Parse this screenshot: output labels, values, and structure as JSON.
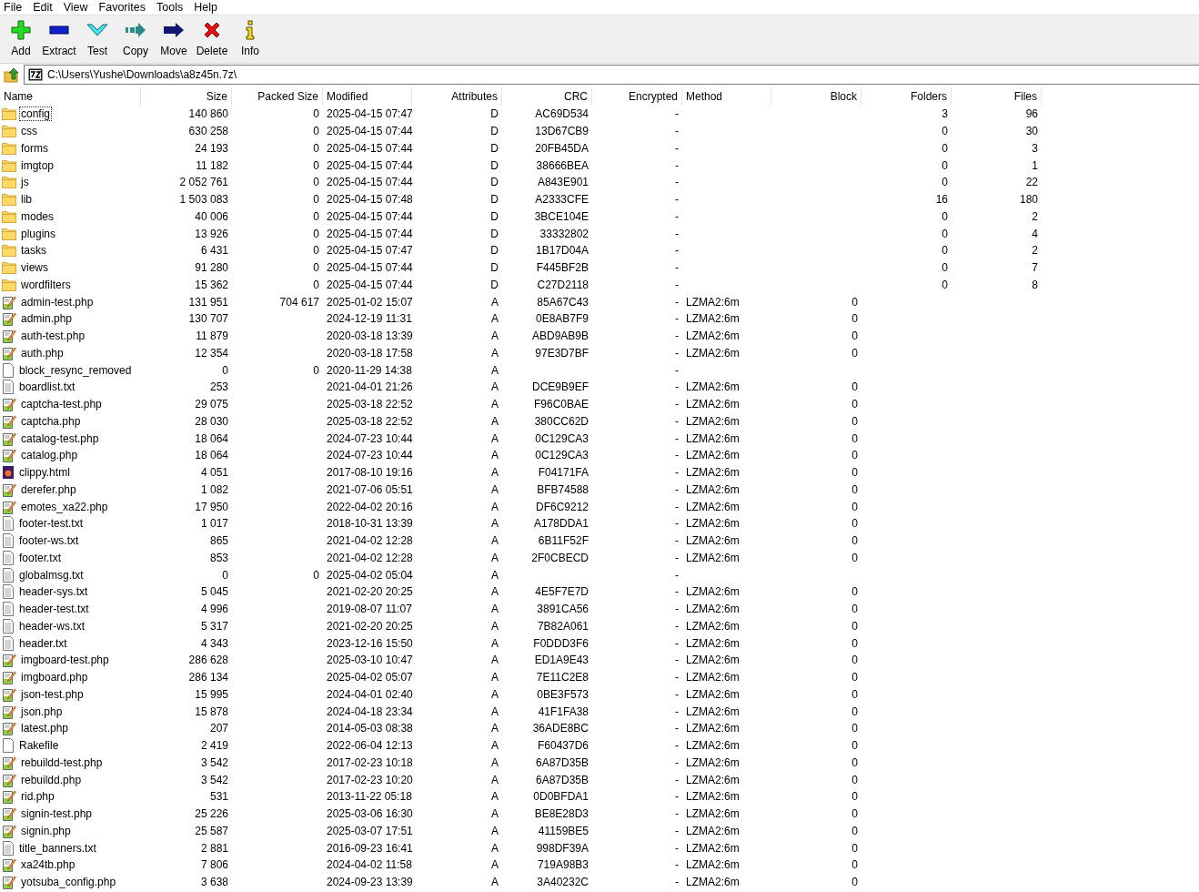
{
  "menu": [
    "File",
    "Edit",
    "View",
    "Favorites",
    "Tools",
    "Help"
  ],
  "toolbar": [
    {
      "kind": "add",
      "label": "Add"
    },
    {
      "kind": "extract",
      "label": "Extract"
    },
    {
      "kind": "test",
      "label": "Test"
    },
    {
      "kind": "copy",
      "label": "Copy"
    },
    {
      "kind": "move",
      "label": "Move"
    },
    {
      "kind": "delete",
      "label": "Delete"
    },
    {
      "kind": "info",
      "label": "Info"
    }
  ],
  "address": {
    "value": "C:\\Users\\Yushe\\Downloads\\a8z45n.7z\\"
  },
  "columns": [
    "Name",
    "Size",
    "Packed Size",
    "Modified",
    "Attributes",
    "CRC",
    "Encrypted",
    "Method",
    "Block",
    "Folders",
    "Files"
  ],
  "rows": [
    {
      "kind": "folder",
      "selected": true,
      "name": "config",
      "size": "140 860",
      "packed_size": "0",
      "modified": "2025-04-15 07:47",
      "attributes": "D",
      "crc": "AC69D534",
      "encrypted": "-",
      "folders": "3",
      "files": "96"
    },
    {
      "kind": "folder",
      "selected": false,
      "name": "css",
      "size": "630 258",
      "packed_size": "0",
      "modified": "2025-04-15 07:44",
      "attributes": "D",
      "crc": "13D67CB9",
      "encrypted": "-",
      "folders": "0",
      "files": "30"
    },
    {
      "kind": "folder",
      "selected": false,
      "name": "forms",
      "size": "24 193",
      "packed_size": "0",
      "modified": "2025-04-15 07:44",
      "attributes": "D",
      "crc": "20FB45DA",
      "encrypted": "-",
      "folders": "0",
      "files": "3"
    },
    {
      "kind": "folder",
      "selected": false,
      "name": "imgtop",
      "size": "11 182",
      "packed_size": "0",
      "modified": "2025-04-15 07:44",
      "attributes": "D",
      "crc": "38666BEA",
      "encrypted": "-",
      "folders": "0",
      "files": "1"
    },
    {
      "kind": "folder",
      "selected": false,
      "name": "js",
      "size": "2 052 761",
      "packed_size": "0",
      "modified": "2025-04-15 07:44",
      "attributes": "D",
      "crc": "A843E901",
      "encrypted": "-",
      "folders": "0",
      "files": "22"
    },
    {
      "kind": "folder",
      "selected": false,
      "name": "lib",
      "size": "1 503 083",
      "packed_size": "0",
      "modified": "2025-04-15 07:48",
      "attributes": "D",
      "crc": "A2333CFE",
      "encrypted": "-",
      "folders": "16",
      "files": "180"
    },
    {
      "kind": "folder",
      "selected": false,
      "name": "modes",
      "size": "40 006",
      "packed_size": "0",
      "modified": "2025-04-15 07:44",
      "attributes": "D",
      "crc": "3BCE104E",
      "encrypted": "-",
      "folders": "0",
      "files": "2"
    },
    {
      "kind": "folder",
      "selected": false,
      "name": "plugins",
      "size": "13 926",
      "packed_size": "0",
      "modified": "2025-04-15 07:44",
      "attributes": "D",
      "crc": "33332802",
      "encrypted": "-",
      "folders": "0",
      "files": "4"
    },
    {
      "kind": "folder",
      "selected": false,
      "name": "tasks",
      "size": "6 431",
      "packed_size": "0",
      "modified": "2025-04-15 07:47",
      "attributes": "D",
      "crc": "1B17D04A",
      "encrypted": "-",
      "folders": "0",
      "files": "2"
    },
    {
      "kind": "folder",
      "selected": false,
      "name": "views",
      "size": "91 280",
      "packed_size": "0",
      "modified": "2025-04-15 07:44",
      "attributes": "D",
      "crc": "F445BF2B",
      "encrypted": "-",
      "folders": "0",
      "files": "7"
    },
    {
      "kind": "folder",
      "selected": false,
      "name": "wordfilters",
      "size": "15 362",
      "packed_size": "0",
      "modified": "2025-04-15 07:44",
      "attributes": "D",
      "crc": "C27D2118",
      "encrypted": "-",
      "folders": "0",
      "files": "8"
    },
    {
      "kind": "script",
      "selected": false,
      "name": "admin-test.php",
      "size": "131 951",
      "packed_size": "704 617",
      "modified": "2025-01-02 15:07",
      "attributes": "A",
      "crc": "85A67C43",
      "encrypted": "-",
      "method": "LZMA2:6m",
      "block": "0"
    },
    {
      "kind": "script",
      "selected": false,
      "name": "admin.php",
      "size": "130 707",
      "modified": "2024-12-19 11:31",
      "attributes": "A",
      "crc": "0E8AB7F9",
      "encrypted": "-",
      "method": "LZMA2:6m",
      "block": "0"
    },
    {
      "kind": "script",
      "selected": false,
      "name": "auth-test.php",
      "size": "11 879",
      "modified": "2020-03-18 13:39",
      "attributes": "A",
      "crc": "ABD9AB9B",
      "encrypted": "-",
      "method": "LZMA2:6m",
      "block": "0"
    },
    {
      "kind": "script",
      "selected": false,
      "name": "auth.php",
      "size": "12 354",
      "modified": "2020-03-18 17:58",
      "attributes": "A",
      "crc": "97E3D7BF",
      "encrypted": "-",
      "method": "LZMA2:6m",
      "block": "0"
    },
    {
      "kind": "blank",
      "selected": false,
      "name": "block_resync_removed",
      "size": "0",
      "packed_size": "0",
      "modified": "2020-11-29 14:38",
      "attributes": "A",
      "encrypted": "-"
    },
    {
      "kind": "text",
      "selected": false,
      "name": "boardlist.txt",
      "size": "253",
      "modified": "2021-04-01 21:26",
      "attributes": "A",
      "crc": "DCE9B9EF",
      "encrypted": "-",
      "method": "LZMA2:6m",
      "block": "0"
    },
    {
      "kind": "script",
      "selected": false,
      "name": "captcha-test.php",
      "size": "29 075",
      "modified": "2025-03-18 22:52",
      "attributes": "A",
      "crc": "F96C0BAE",
      "encrypted": "-",
      "method": "LZMA2:6m",
      "block": "0"
    },
    {
      "kind": "script",
      "selected": false,
      "name": "captcha.php",
      "size": "28 030",
      "modified": "2025-03-18 22:52",
      "attributes": "A",
      "crc": "380CC62D",
      "encrypted": "-",
      "method": "LZMA2:6m",
      "block": "0"
    },
    {
      "kind": "script",
      "selected": false,
      "name": "catalog-test.php",
      "size": "18 064",
      "modified": "2024-07-23 10:44",
      "attributes": "A",
      "crc": "0C129CA3",
      "encrypted": "-",
      "method": "LZMA2:6m",
      "block": "0"
    },
    {
      "kind": "script",
      "selected": false,
      "name": "catalog.php",
      "size": "18 064",
      "modified": "2024-07-23 10:44",
      "attributes": "A",
      "crc": "0C129CA3",
      "encrypted": "-",
      "method": "LZMA2:6m",
      "block": "0"
    },
    {
      "kind": "html",
      "selected": false,
      "name": "clippy.html",
      "size": "4 051",
      "modified": "2017-08-10 19:16",
      "attributes": "A",
      "crc": "F04171FA",
      "encrypted": "-",
      "method": "LZMA2:6m",
      "block": "0"
    },
    {
      "kind": "script",
      "selected": false,
      "name": "derefer.php",
      "size": "1 082",
      "modified": "2021-07-06 05:51",
      "attributes": "A",
      "crc": "BFB74588",
      "encrypted": "-",
      "method": "LZMA2:6m",
      "block": "0"
    },
    {
      "kind": "script",
      "selected": false,
      "name": "emotes_xa22.php",
      "size": "17 950",
      "modified": "2022-04-02 20:16",
      "attributes": "A",
      "crc": "DF6C9212",
      "encrypted": "-",
      "method": "LZMA2:6m",
      "block": "0"
    },
    {
      "kind": "text",
      "selected": false,
      "name": "footer-test.txt",
      "size": "1 017",
      "modified": "2018-10-31 13:39",
      "attributes": "A",
      "crc": "A178DDA1",
      "encrypted": "-",
      "method": "LZMA2:6m",
      "block": "0"
    },
    {
      "kind": "text",
      "selected": false,
      "name": "footer-ws.txt",
      "size": "865",
      "modified": "2021-04-02 12:28",
      "attributes": "A",
      "crc": "6B11F52F",
      "encrypted": "-",
      "method": "LZMA2:6m",
      "block": "0"
    },
    {
      "kind": "text",
      "selected": false,
      "name": "footer.txt",
      "size": "853",
      "modified": "2021-04-02 12:28",
      "attributes": "A",
      "crc": "2F0CBECD",
      "encrypted": "-",
      "method": "LZMA2:6m",
      "block": "0"
    },
    {
      "kind": "text",
      "selected": false,
      "name": "globalmsg.txt",
      "size": "0",
      "packed_size": "0",
      "modified": "2025-04-02 05:04",
      "attributes": "A",
      "encrypted": "-"
    },
    {
      "kind": "text",
      "selected": false,
      "name": "header-sys.txt",
      "size": "5 045",
      "modified": "2021-02-20 20:25",
      "attributes": "A",
      "crc": "4E5F7E7D",
      "encrypted": "-",
      "method": "LZMA2:6m",
      "block": "0"
    },
    {
      "kind": "text",
      "selected": false,
      "name": "header-test.txt",
      "size": "4 996",
      "modified": "2019-08-07 11:07",
      "attributes": "A",
      "crc": "3891CA56",
      "encrypted": "-",
      "method": "LZMA2:6m",
      "block": "0"
    },
    {
      "kind": "text",
      "selected": false,
      "name": "header-ws.txt",
      "size": "5 317",
      "modified": "2021-02-20 20:25",
      "attributes": "A",
      "crc": "7B82A061",
      "encrypted": "-",
      "method": "LZMA2:6m",
      "block": "0"
    },
    {
      "kind": "text",
      "selected": false,
      "name": "header.txt",
      "size": "4 343",
      "modified": "2023-12-16 15:50",
      "attributes": "A",
      "crc": "F0DDD3F6",
      "encrypted": "-",
      "method": "LZMA2:6m",
      "block": "0"
    },
    {
      "kind": "script",
      "selected": false,
      "name": "imgboard-test.php",
      "size": "286 628",
      "modified": "2025-03-10 10:47",
      "attributes": "A",
      "crc": "ED1A9E43",
      "encrypted": "-",
      "method": "LZMA2:6m",
      "block": "0"
    },
    {
      "kind": "script",
      "selected": false,
      "name": "imgboard.php",
      "size": "286 134",
      "modified": "2025-04-02 05:07",
      "attributes": "A",
      "crc": "7E11C2E8",
      "encrypted": "-",
      "method": "LZMA2:6m",
      "block": "0"
    },
    {
      "kind": "script",
      "selected": false,
      "name": "json-test.php",
      "size": "15 995",
      "modified": "2024-04-01 02:40",
      "attributes": "A",
      "crc": "0BE3F573",
      "encrypted": "-",
      "method": "LZMA2:6m",
      "block": "0"
    },
    {
      "kind": "script",
      "selected": false,
      "name": "json.php",
      "size": "15 878",
      "modified": "2024-04-18 23:34",
      "attributes": "A",
      "crc": "41F1FA38",
      "encrypted": "-",
      "method": "LZMA2:6m",
      "block": "0"
    },
    {
      "kind": "script",
      "selected": false,
      "name": "latest.php",
      "size": "207",
      "modified": "2014-05-03 08:38",
      "attributes": "A",
      "crc": "36ADE8BC",
      "encrypted": "-",
      "method": "LZMA2:6m",
      "block": "0"
    },
    {
      "kind": "blank",
      "selected": false,
      "name": "Rakefile",
      "size": "2 419",
      "modified": "2022-06-04 12:13",
      "attributes": "A",
      "crc": "F60437D6",
      "encrypted": "-",
      "method": "LZMA2:6m",
      "block": "0"
    },
    {
      "kind": "script",
      "selected": false,
      "name": "rebuildd-test.php",
      "size": "3 542",
      "modified": "2017-02-23 10:18",
      "attributes": "A",
      "crc": "6A87D35B",
      "encrypted": "-",
      "method": "LZMA2:6m",
      "block": "0"
    },
    {
      "kind": "script",
      "selected": false,
      "name": "rebuildd.php",
      "size": "3 542",
      "modified": "2017-02-23 10:20",
      "attributes": "A",
      "crc": "6A87D35B",
      "encrypted": "-",
      "method": "LZMA2:6m",
      "block": "0"
    },
    {
      "kind": "script",
      "selected": false,
      "name": "rid.php",
      "size": "531",
      "modified": "2013-11-22 05:18",
      "attributes": "A",
      "crc": "0D0BFDA1",
      "encrypted": "-",
      "method": "LZMA2:6m",
      "block": "0"
    },
    {
      "kind": "script",
      "selected": false,
      "name": "signin-test.php",
      "size": "25 226",
      "modified": "2025-03-06 16:30",
      "attributes": "A",
      "crc": "BE8E28D3",
      "encrypted": "-",
      "method": "LZMA2:6m",
      "block": "0"
    },
    {
      "kind": "script",
      "selected": false,
      "name": "signin.php",
      "size": "25 587",
      "modified": "2025-03-07 17:51",
      "attributes": "A",
      "crc": "41159BE5",
      "encrypted": "-",
      "method": "LZMA2:6m",
      "block": "0"
    },
    {
      "kind": "text",
      "selected": false,
      "name": "title_banners.txt",
      "size": "2 881",
      "modified": "2016-09-23 16:41",
      "attributes": "A",
      "crc": "998DF39A",
      "encrypted": "-",
      "method": "LZMA2:6m",
      "block": "0"
    },
    {
      "kind": "script",
      "selected": false,
      "name": "xa24tb.php",
      "size": "7 806",
      "modified": "2024-04-02 11:58",
      "attributes": "A",
      "crc": "719A98B3",
      "encrypted": "-",
      "method": "LZMA2:6m",
      "block": "0"
    },
    {
      "kind": "script",
      "selected": false,
      "name": "yotsuba_config.php",
      "size": "3 638",
      "modified": "2024-09-23 13:39",
      "attributes": "A",
      "crc": "3A40232C",
      "encrypted": "-",
      "method": "LZMA2:6m",
      "block": "0"
    }
  ]
}
